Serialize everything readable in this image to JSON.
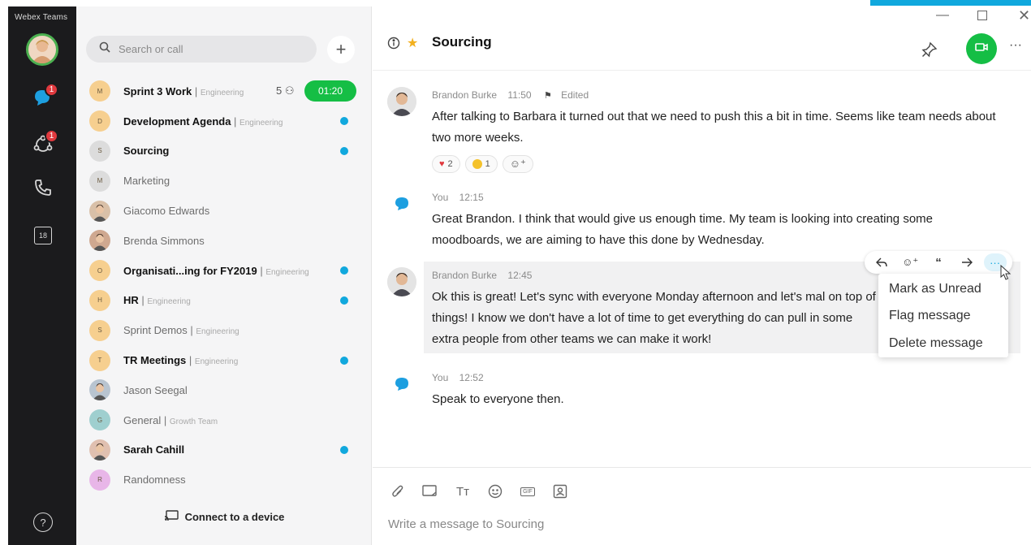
{
  "app": {
    "title": "Webex Teams"
  },
  "rail": {
    "items": [
      {
        "icon": "chat-bubble-icon",
        "badge": "1"
      },
      {
        "icon": "teams-icon",
        "badge": "1"
      },
      {
        "icon": "phone-icon"
      },
      {
        "icon": "calendar-icon",
        "label": "18"
      },
      {
        "icon": "help-icon"
      }
    ]
  },
  "sidebar": {
    "search_placeholder": "Search or call",
    "connect_label": "Connect to a device",
    "spaces": [
      {
        "name": "Sprint 3 Work",
        "team": "Engineering",
        "initial": "M",
        "bold": true,
        "count": "5",
        "timer": "01:20",
        "avatar_color": "#f6cf8f"
      },
      {
        "name": "Development Agenda",
        "team": "Engineering",
        "initial": "D",
        "bold": true,
        "unread": true,
        "avatar_color": "#f6cf8f"
      },
      {
        "name": "Sourcing",
        "team": "",
        "initial": "S",
        "bold": true,
        "unread": true,
        "avatar_color": "#dcdcdc"
      },
      {
        "name": "Marketing",
        "team": "",
        "initial": "M",
        "bold": false,
        "avatar_color": "#dcdcdc"
      },
      {
        "name": "Giacomo Edwards",
        "team": "",
        "initial": "",
        "bold": false,
        "person": true,
        "avatar_color": "#d9c0a8"
      },
      {
        "name": "Brenda Simmons",
        "team": "",
        "initial": "",
        "bold": false,
        "person": true,
        "avatar_color": "#cfa890"
      },
      {
        "name": "Organisati...ing for FY2019",
        "team": "Engineering",
        "initial": "O",
        "bold": true,
        "unread": true,
        "avatar_color": "#f6cf8f"
      },
      {
        "name": "HR",
        "team": "Engineering",
        "initial": "H",
        "bold": true,
        "unread": true,
        "avatar_color": "#f6cf8f"
      },
      {
        "name": "Sprint Demos",
        "team": "Engineering",
        "initial": "S",
        "bold": false,
        "avatar_color": "#f6cf8f"
      },
      {
        "name": "TR Meetings",
        "team": "Engineering",
        "initial": "T",
        "bold": true,
        "unread": true,
        "avatar_color": "#f6cf8f"
      },
      {
        "name": "Jason Seegal",
        "team": "",
        "initial": "",
        "bold": false,
        "person": true,
        "avatar_color": "#b8c4d0"
      },
      {
        "name": "General",
        "team": "Growth Team",
        "initial": "G",
        "bold": false,
        "avatar_color": "#9fcfcf"
      },
      {
        "name": "Sarah Cahill",
        "team": "",
        "initial": "",
        "bold": true,
        "person": true,
        "unread": true,
        "avatar_color": "#e0c0b0"
      },
      {
        "name": "Randomness",
        "team": "",
        "initial": "R",
        "bold": false,
        "avatar_color": "#e8b6e8"
      }
    ]
  },
  "space": {
    "title": "Sourcing"
  },
  "messages": [
    {
      "author": "Brandon Burke",
      "time": "11:50",
      "flag": "Edited",
      "text": "After talking to Barbara it turned out that we need to push this a bit in time. Seems like team needs about two more weeks.",
      "reactions": [
        {
          "icon": "heart-icon",
          "count": "2"
        },
        {
          "icon": "grin-icon",
          "count": "1"
        }
      ]
    },
    {
      "author": "You",
      "time": "12:15",
      "text": "Great Brandon. I think that would give us enough time. My team is looking into creating some moodboards, we are aiming to have this done by Wednesday."
    },
    {
      "author": "Brandon Burke",
      "time": "12:45",
      "text": "Ok this is great! Let's sync with everyone Monday afternoon and let's mal on top of things! I know we don't have a lot of time to get everything do can pull in some extra people from other teams we can make it work!"
    },
    {
      "author": "You",
      "time": "12:52",
      "text": "Speak to everyone then."
    }
  ],
  "context_menu": {
    "items": [
      "Mark as Unread",
      "Flag message",
      "Delete message"
    ]
  },
  "composer": {
    "placeholder": "Write a message to Sourcing"
  },
  "colors": {
    "accent": "#11a8dd",
    "green": "#15be45",
    "badge": "#e0393e"
  }
}
